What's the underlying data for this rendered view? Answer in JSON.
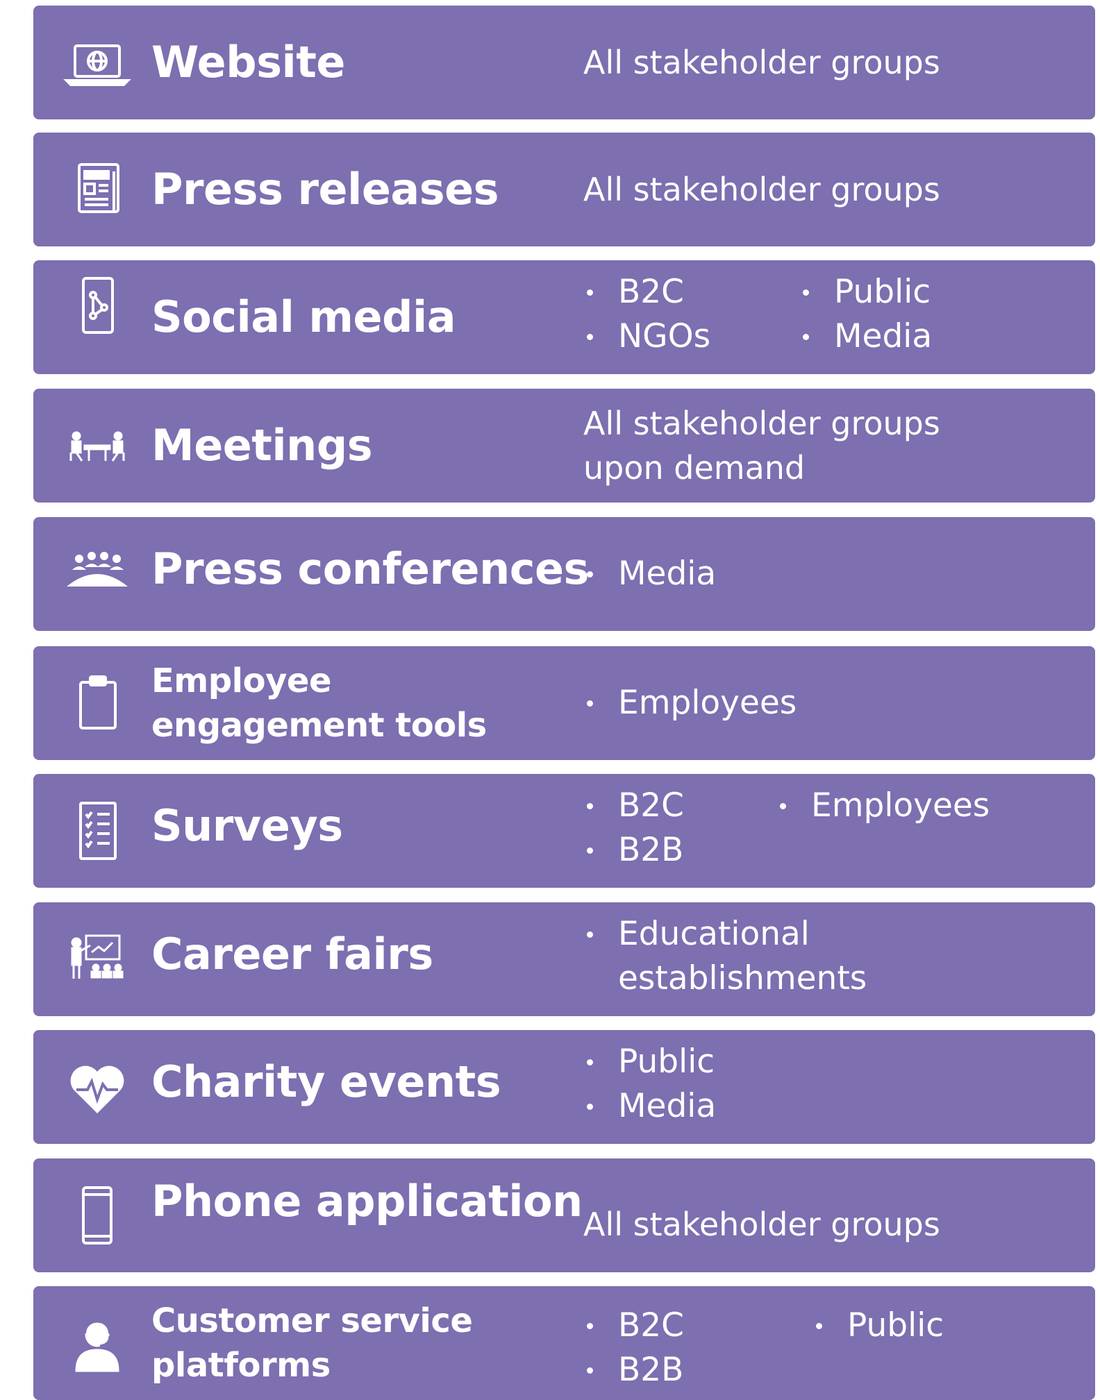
{
  "accent_color": "#7d6fb0",
  "rows": [
    {
      "title": "Website",
      "icon": "laptop-globe-icon",
      "text": "All stakeholder groups"
    },
    {
      "title": "Press releases",
      "icon": "newspaper-icon",
      "text": "All stakeholder groups"
    },
    {
      "title": "Social media",
      "icon": "phone-network-icon",
      "col1": [
        "B2C",
        "NGOs"
      ],
      "col2": [
        "Public",
        "Media"
      ]
    },
    {
      "title": "Meetings",
      "icon": "meeting-table-icon",
      "text_lines": [
        "All stakeholder groups",
        "upon demand"
      ]
    },
    {
      "title": "Press conferences",
      "icon": "audience-icon",
      "col1": [
        "Media"
      ]
    },
    {
      "title_lines": [
        "Employee",
        "engagement tools"
      ],
      "icon": "clipboard-icon",
      "col1": [
        "Employees"
      ]
    },
    {
      "title": "Surveys",
      "icon": "checklist-icon",
      "col1": [
        "B2C",
        "B2B"
      ],
      "col2": [
        "Employees"
      ]
    },
    {
      "title": "Career fairs",
      "icon": "presentation-icon",
      "col1_lines": [
        "Educational",
        "establishments"
      ]
    },
    {
      "title": "Charity events",
      "icon": "heart-pulse-icon",
      "col1": [
        "Public",
        "Media"
      ]
    },
    {
      "title": "Phone application",
      "icon": "smartphone-icon",
      "text": "All stakeholder groups"
    },
    {
      "title_lines": [
        "Customer service",
        "platforms"
      ],
      "icon": "headset-agent-icon",
      "col1": [
        "B2C",
        "B2B"
      ],
      "col2": [
        "Public"
      ]
    }
  ]
}
